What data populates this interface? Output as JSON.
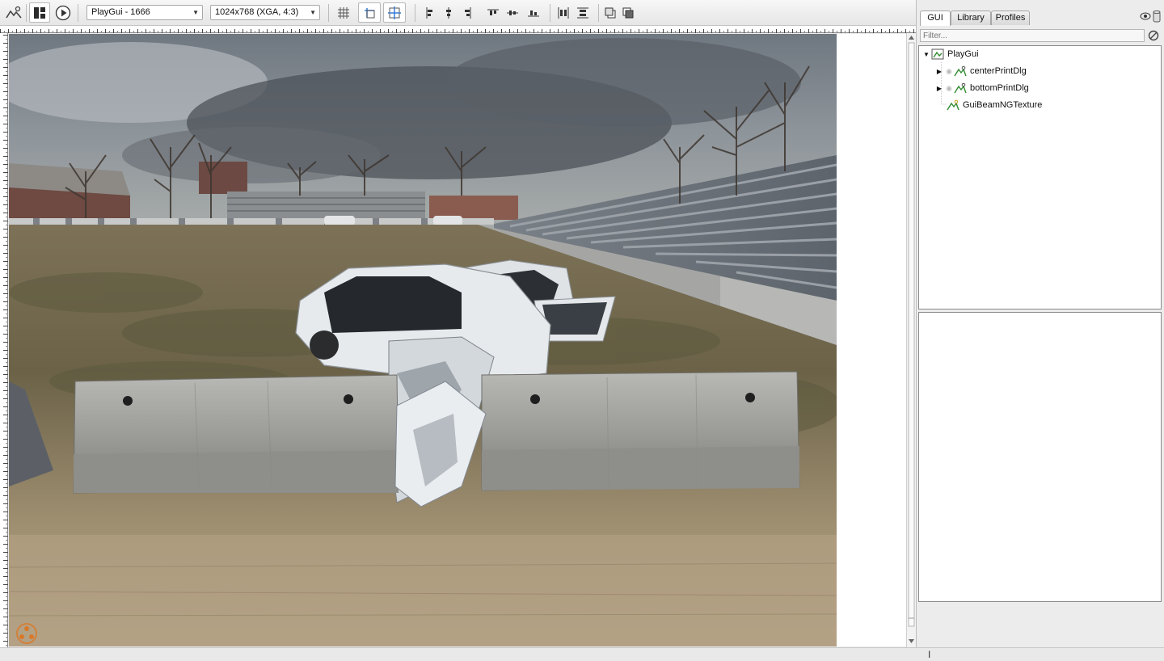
{
  "toolbar": {
    "gui_selector": "PlayGui - 1666",
    "resolution_selector": "1024x768 (XGA, 4:3)"
  },
  "panel": {
    "tabs": [
      {
        "label": "GUI"
      },
      {
        "label": "Library"
      },
      {
        "label": "Profiles"
      }
    ],
    "filter_placeholder": "Filter...",
    "tree": {
      "root": "PlayGui",
      "children": [
        {
          "label": "centerPrintDlg"
        },
        {
          "label": "bottomPrintDlg"
        },
        {
          "label": "GuiBeamNGTexture"
        }
      ]
    }
  },
  "colors": {
    "accent": "#3a7bd5",
    "tree_icon_green": "#2e8b2e",
    "logo_orange": "#d8792a"
  }
}
